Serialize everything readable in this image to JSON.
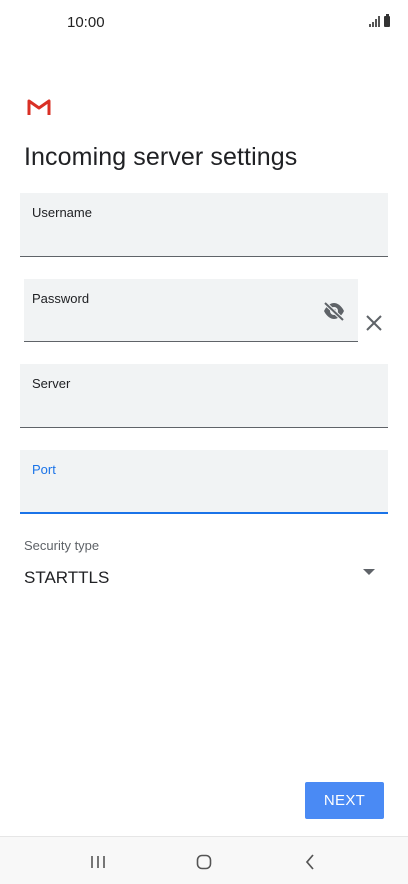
{
  "status_bar": {
    "time": "10:00"
  },
  "title": "Incoming server settings",
  "fields": {
    "username": {
      "label": "Username",
      "value": ""
    },
    "password": {
      "label": "Password",
      "value": ""
    },
    "server": {
      "label": "Server",
      "value": ""
    },
    "port": {
      "label": "Port",
      "value": ""
    }
  },
  "security": {
    "label": "Security type",
    "value": "STARTTLS"
  },
  "next_label": "NEXT",
  "colors": {
    "accent": "#1a73e8",
    "button": "#4a8af4",
    "field_bg": "#f1f3f4"
  },
  "icons": [
    "gmail-logo",
    "visibility-off-icon",
    "close-icon",
    "dropdown-arrow-icon",
    "recents-icon",
    "home-icon",
    "back-icon"
  ]
}
